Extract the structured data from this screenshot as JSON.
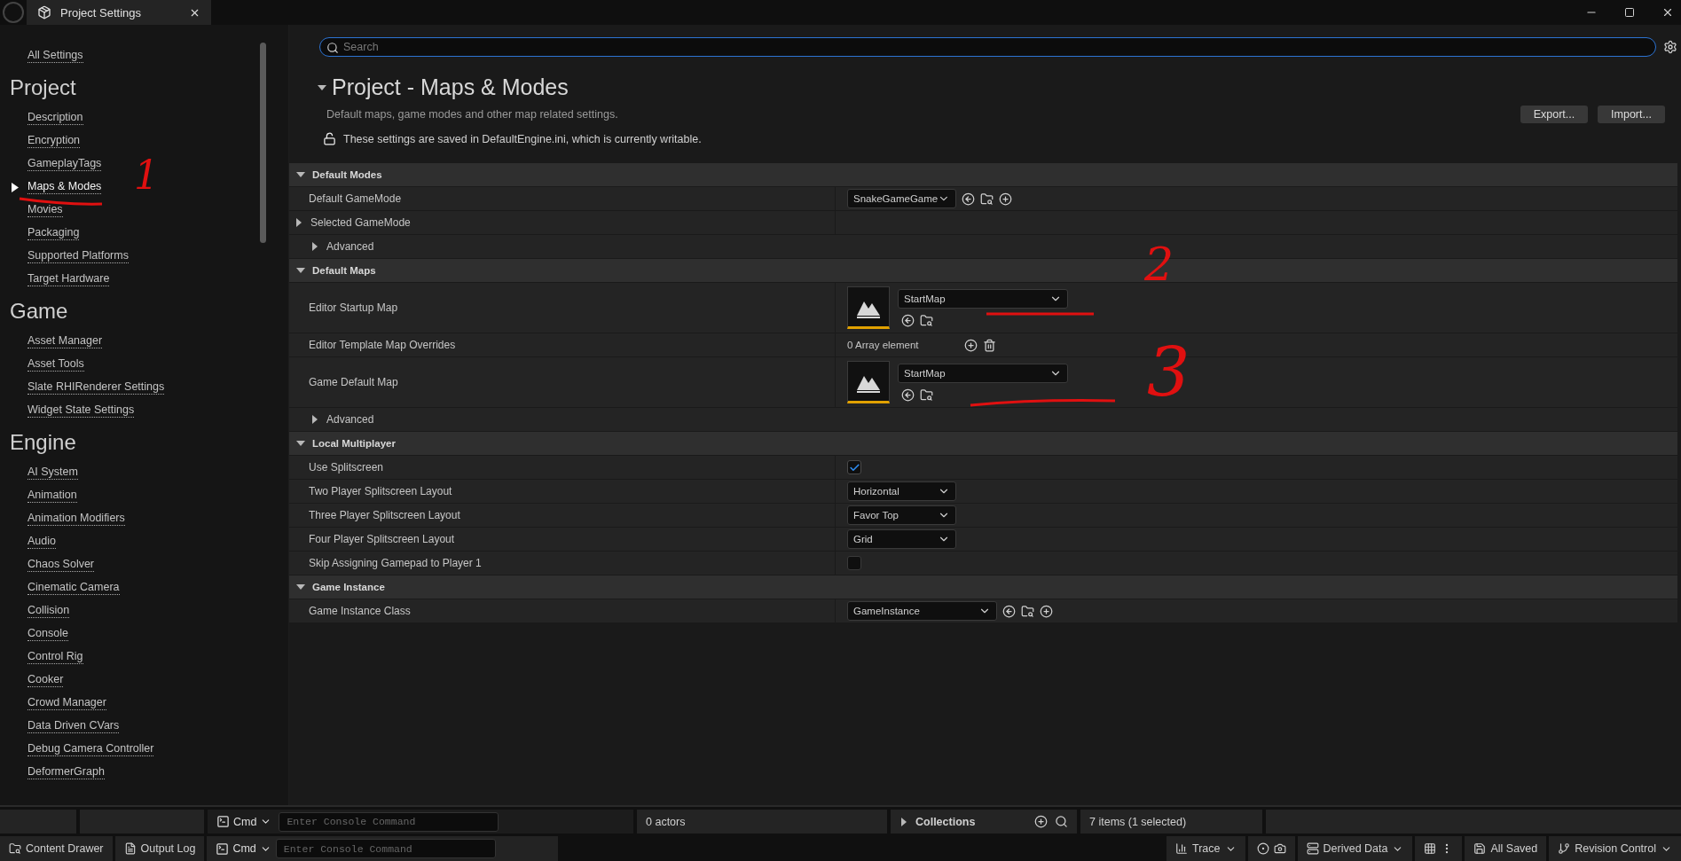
{
  "tab": {
    "title": "Project Settings"
  },
  "sidebar": {
    "top_link": "All Settings",
    "sections": [
      {
        "title": "Project",
        "items": [
          {
            "label": "Description",
            "selected": false
          },
          {
            "label": "Encryption",
            "selected": false
          },
          {
            "label": "GameplayTags",
            "selected": false
          },
          {
            "label": "Maps & Modes",
            "selected": true
          },
          {
            "label": "Movies",
            "selected": false
          },
          {
            "label": "Packaging",
            "selected": false
          },
          {
            "label": "Supported Platforms",
            "selected": false
          },
          {
            "label": "Target Hardware",
            "selected": false
          }
        ]
      },
      {
        "title": "Game",
        "items": [
          {
            "label": "Asset Manager",
            "selected": false
          },
          {
            "label": "Asset Tools",
            "selected": false
          },
          {
            "label": "Slate RHIRenderer Settings",
            "selected": false
          },
          {
            "label": "Widget State Settings",
            "selected": false
          }
        ]
      },
      {
        "title": "Engine",
        "items": [
          {
            "label": "AI System",
            "selected": false
          },
          {
            "label": "Animation",
            "selected": false
          },
          {
            "label": "Animation Modifiers",
            "selected": false
          },
          {
            "label": "Audio",
            "selected": false
          },
          {
            "label": "Chaos Solver",
            "selected": false
          },
          {
            "label": "Cinematic Camera",
            "selected": false
          },
          {
            "label": "Collision",
            "selected": false
          },
          {
            "label": "Console",
            "selected": false
          },
          {
            "label": "Control Rig",
            "selected": false
          },
          {
            "label": "Cooker",
            "selected": false
          },
          {
            "label": "Crowd Manager",
            "selected": false
          },
          {
            "label": "Data Driven CVars",
            "selected": false
          },
          {
            "label": "Debug Camera Controller",
            "selected": false
          },
          {
            "label": "DeformerGraph",
            "selected": false
          }
        ]
      }
    ]
  },
  "search": {
    "placeholder": "Search"
  },
  "page": {
    "title": "Project - Maps & Modes",
    "description": "Default maps, game modes and other map related settings.",
    "writable_note": "These settings are saved in DefaultEngine.ini, which is currently writable.",
    "buttons": [
      "Export...",
      "Import..."
    ]
  },
  "categories": [
    {
      "title": "Default Modes",
      "expanded": true,
      "rows": [
        {
          "kind": "class",
          "label": "Default GameMode",
          "value": "SnakeGameGame"
        },
        {
          "kind": "group",
          "label": "Selected GameMode",
          "expanded": false
        },
        {
          "kind": "advanced",
          "label": "Advanced",
          "expanded": false
        }
      ]
    },
    {
      "title": "Default Maps",
      "expanded": true,
      "rows": [
        {
          "kind": "asset",
          "label": "Editor Startup Map",
          "value": "StartMap"
        },
        {
          "kind": "array",
          "label": "Editor Template Map Overrides",
          "value": "0 Array element"
        },
        {
          "kind": "asset",
          "label": "Game Default Map",
          "value": "StartMap"
        },
        {
          "kind": "advanced",
          "label": "Advanced",
          "expanded": false
        }
      ]
    },
    {
      "title": "Local Multiplayer",
      "expanded": true,
      "rows": [
        {
          "kind": "checkbox",
          "label": "Use Splitscreen",
          "checked": true
        },
        {
          "kind": "enum",
          "label": "Two Player Splitscreen Layout",
          "value": "Horizontal"
        },
        {
          "kind": "enum",
          "label": "Three Player Splitscreen Layout",
          "value": "Favor Top"
        },
        {
          "kind": "enum",
          "label": "Four Player Splitscreen Layout",
          "value": "Grid"
        },
        {
          "kind": "checkbox",
          "label": "Skip Assigning Gamepad to Player 1",
          "checked": false
        }
      ]
    },
    {
      "title": "Game Instance",
      "expanded": true,
      "rows": [
        {
          "kind": "class",
          "label": "Game Instance Class",
          "value": "GameInstance"
        }
      ]
    }
  ],
  "console_bar": {
    "cmd": "Cmd",
    "placeholder": "Enter Console Command",
    "actors": "0 actors",
    "collections": "Collections",
    "items": "7 items (1 selected)"
  },
  "status_bar": {
    "content_drawer": "Content Drawer",
    "output_log": "Output Log",
    "cmd": "Cmd",
    "placeholder": "Enter Console Command",
    "trace": "Trace",
    "derived_data": "Derived Data",
    "saved": "All Saved",
    "revision_control": "Revision Control"
  },
  "annotations": [
    {
      "text": "1"
    },
    {
      "text": "2"
    },
    {
      "text": "3"
    }
  ]
}
